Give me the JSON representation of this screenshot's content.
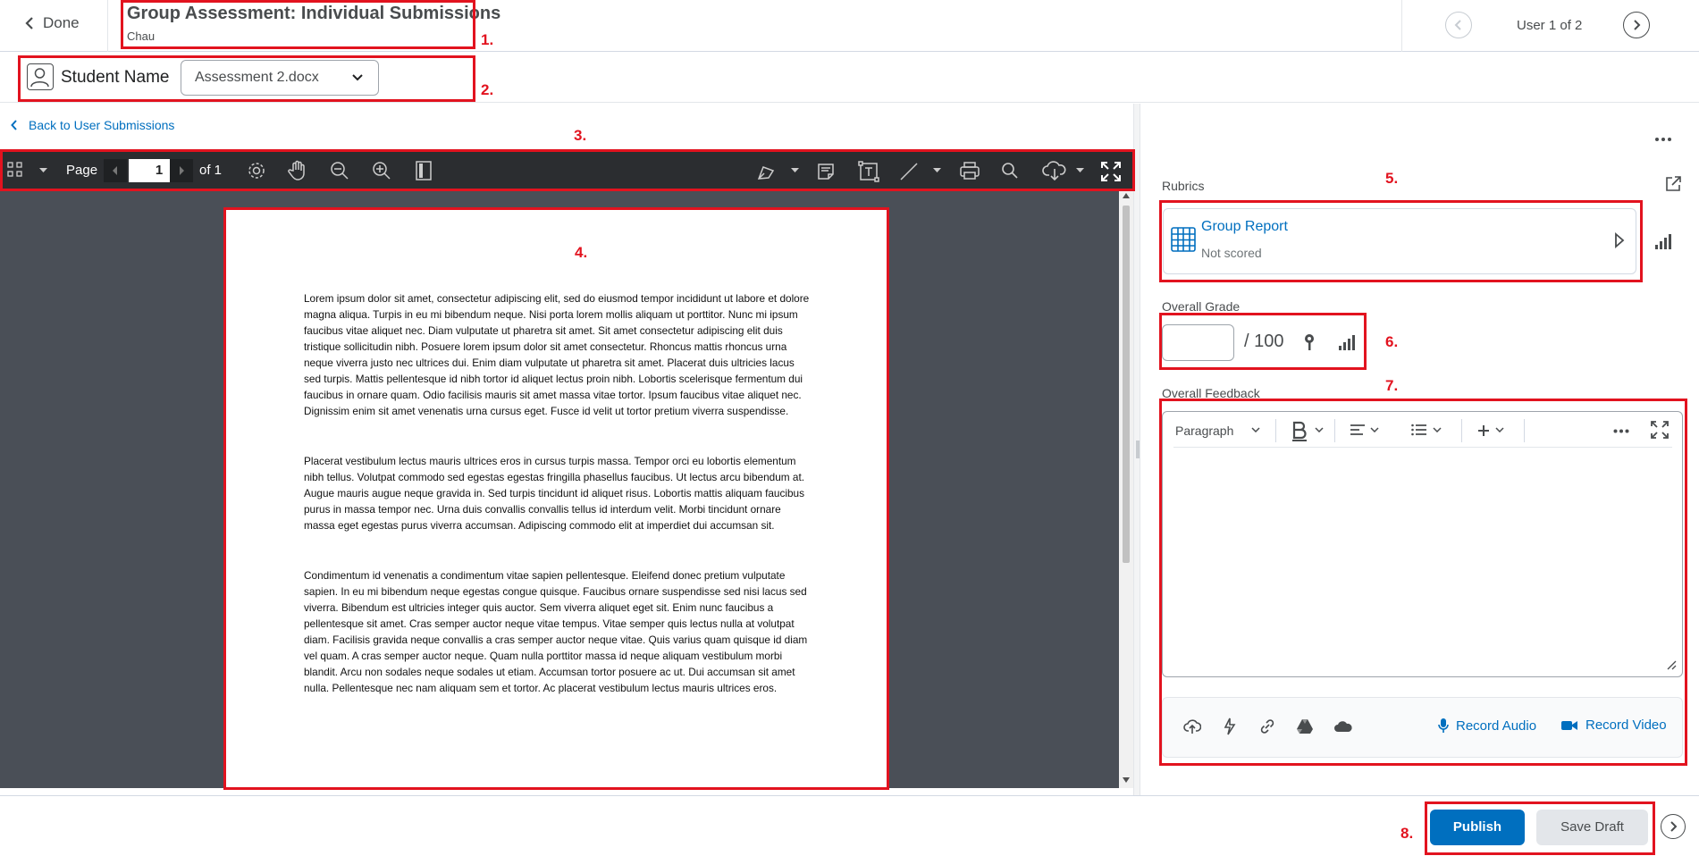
{
  "header": {
    "done_label": "Done",
    "title": "Group Assessment: Individual Submissions",
    "subtitle": "Chau",
    "user_count": "User 1 of 2"
  },
  "submission": {
    "student_name": "Student Name",
    "selected_file": "Assessment 2.docx"
  },
  "viewer": {
    "back_link": "Back to User Submissions",
    "page_label": "Page",
    "page_value": "1",
    "page_total": "of 1",
    "paragraphs": [
      "Lorem ipsum dolor sit amet, consectetur adipiscing elit, sed do eiusmod tempor incididunt ut labore et dolore magna aliqua. Turpis in eu mi bibendum neque. Nisi porta lorem mollis aliquam ut porttitor. Nunc mi ipsum faucibus vitae aliquet nec. Diam vulputate ut pharetra sit amet. Sit amet consectetur adipiscing elit duis tristique sollicitudin nibh. Posuere lorem ipsum dolor sit amet consectetur. Rhoncus mattis rhoncus urna neque viverra justo nec ultrices dui. Enim diam vulputate ut pharetra sit amet. Placerat duis ultricies lacus sed turpis. Mattis pellentesque id nibh tortor id aliquet lectus proin nibh. Lobortis scelerisque fermentum dui faucibus in ornare quam. Odio facilisis mauris sit amet massa vitae tortor. Ipsum faucibus vitae aliquet nec. Dignissim enim sit amet venenatis urna cursus eget. Fusce id velit ut tortor pretium viverra suspendisse.",
      "Placerat vestibulum lectus mauris ultrices eros in cursus turpis massa. Tempor orci eu lobortis elementum nibh tellus. Volutpat commodo sed egestas egestas fringilla phasellus faucibus. Ut lectus arcu bibendum at. Augue mauris augue neque gravida in. Sed turpis tincidunt id aliquet risus. Lobortis mattis aliquam faucibus purus in massa tempor nec. Urna duis convallis convallis tellus id interdum velit. Morbi tincidunt ornare massa eget egestas purus viverra accumsan. Adipiscing commodo elit at imperdiet dui accumsan sit.",
      "Condimentum id venenatis a condimentum vitae sapien pellentesque. Eleifend donec pretium vulputate sapien. In eu mi bibendum neque egestas congue quisque. Faucibus ornare suspendisse sed nisi lacus sed viverra. Bibendum est ultricies integer quis auctor. Sem viverra aliquet eget sit. Enim nunc faucibus a pellentesque sit amet. Cras semper auctor neque vitae tempus. Vitae semper quis lectus nulla at volutpat diam. Facilisis gravida neque convallis a cras semper auctor neque vitae. Quis varius quam quisque id diam vel quam. A cras semper auctor neque. Quam nulla porttitor massa id neque aliquam vestibulum morbi blandit. Arcu non sodales neque sodales ut etiam. Accumsan tortor posuere ac ut. Dui accumsan sit amet nulla. Pellentesque nec nam aliquam sem et tortor. Ac placerat vestibulum lectus mauris ultrices eros."
    ]
  },
  "evaluation": {
    "rubrics_label": "Rubrics",
    "rubric_name": "Group Report",
    "rubric_status": "Not scored",
    "overall_grade_label": "Overall Grade",
    "grade_value": "",
    "grade_max": "/ 100",
    "overall_feedback_label": "Overall Feedback",
    "paragraph_style": "Paragraph",
    "record_audio": "Record Audio",
    "record_video": "Record Video"
  },
  "actions": {
    "publish": "Publish",
    "save_draft": "Save Draft"
  },
  "annotations": [
    "1.",
    "2.",
    "3.",
    "4.",
    "5.",
    "6.",
    "7.",
    "8."
  ],
  "colors": {
    "accent": "#006fbf",
    "annotation": "#e2131f",
    "toolbar_bg": "#2b2d30",
    "viewer_bg": "#4a4f57"
  }
}
